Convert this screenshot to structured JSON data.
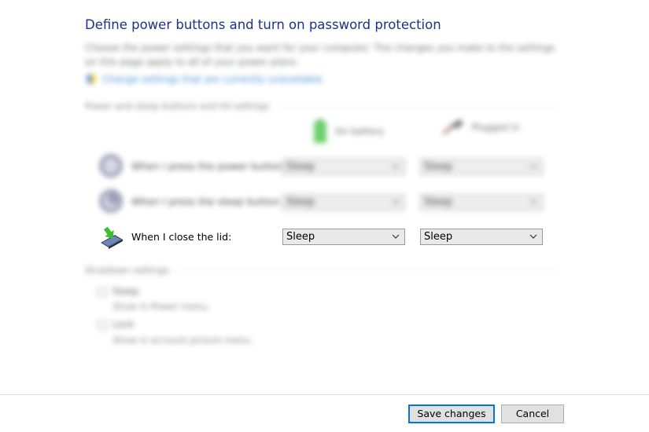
{
  "title": "Define power buttons and turn on password protection",
  "description": "Choose the power settings that you want for your computer. The changes you make to the settings on this page apply to all of your power plans.",
  "admin_link": "Change settings that are currently unavailable",
  "buttons_section": {
    "title": "Power and sleep buttons and lid settings",
    "on_battery": "On battery",
    "plugged_in": "Plugged in",
    "rows": [
      {
        "label": "When I press the power button:",
        "battery": "Sleep",
        "plugged": "Sleep"
      },
      {
        "label": "When I press the sleep button:",
        "battery": "Sleep",
        "plugged": "Sleep"
      },
      {
        "label": "When I close the lid:",
        "battery": "Sleep",
        "plugged": "Sleep"
      }
    ]
  },
  "shutdown_section": {
    "title": "Shutdown settings",
    "items": [
      {
        "label": "Sleep",
        "desc": "Show in Power menu."
      },
      {
        "label": "Lock",
        "desc": "Show in account picture menu."
      }
    ]
  },
  "footer": {
    "save": "Save changes",
    "cancel": "Cancel"
  },
  "colors": {
    "title": "#1e3287",
    "link": "#0a66c2",
    "accent": "#0078d7"
  }
}
